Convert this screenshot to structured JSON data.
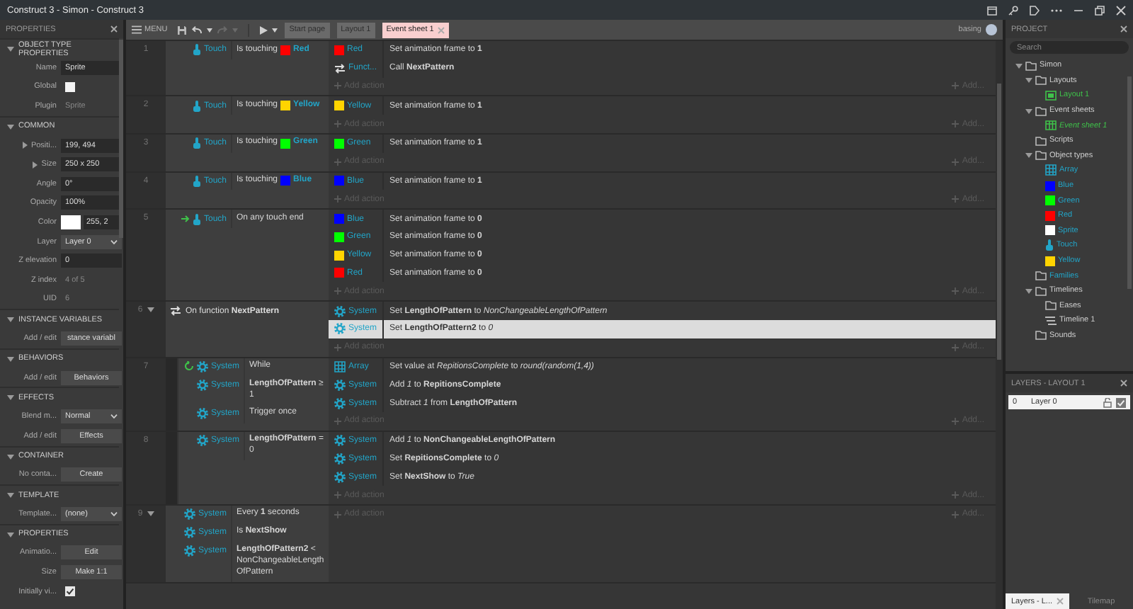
{
  "title_bar": {
    "title": "Construct 3 - Simon - Construct 3"
  },
  "properties": {
    "title": "PROPERTIES",
    "sections": [
      {
        "title": "OBJECT TYPE PROPERTIES",
        "expanded": true,
        "rows": [
          {
            "kind": "field",
            "label": "Name",
            "value": "Sprite"
          },
          {
            "kind": "checkbox",
            "label": "Global",
            "checked": false
          },
          {
            "kind": "text",
            "label": "Plugin",
            "value": "Sprite"
          }
        ]
      },
      {
        "title": "COMMON",
        "expanded": true,
        "rows": [
          {
            "kind": "field",
            "label": "Positi...",
            "value": "199, 494",
            "expanded": false
          },
          {
            "kind": "field",
            "label": "Size",
            "value": "250 x 250",
            "expanded": false
          },
          {
            "kind": "field",
            "label": "Angle",
            "value": "0°"
          },
          {
            "kind": "field",
            "label": "Opacity",
            "value": "100%"
          },
          {
            "kind": "color",
            "label": "Color",
            "color": "#ffffff",
            "value": "255, 2"
          },
          {
            "kind": "select",
            "label": "Layer",
            "value": "Layer 0"
          },
          {
            "kind": "field",
            "label": "Z elevation",
            "value": "0"
          },
          {
            "kind": "text",
            "label": "Z index",
            "value": "4 of 5"
          },
          {
            "kind": "text",
            "label": "UID",
            "value": "6"
          }
        ]
      },
      {
        "title": "INSTANCE VARIABLES",
        "expanded": true,
        "rows": [
          {
            "kind": "button",
            "label": "Add / edit",
            "value": "stance variabl"
          }
        ]
      },
      {
        "title": "BEHAVIORS",
        "expanded": true,
        "rows": [
          {
            "kind": "button",
            "label": "Add / edit",
            "value": "Behaviors"
          }
        ]
      },
      {
        "title": "EFFECTS",
        "expanded": true,
        "rows": [
          {
            "kind": "select",
            "label": "Blend m...",
            "value": "Normal"
          },
          {
            "kind": "button",
            "label": "Add / edit",
            "value": "Effects"
          }
        ]
      },
      {
        "title": "CONTAINER",
        "expanded": true,
        "rows": [
          {
            "kind": "button",
            "label": "No conta...",
            "value": "Create"
          }
        ]
      },
      {
        "title": "TEMPLATE",
        "expanded": true,
        "rows": [
          {
            "kind": "select",
            "label": "Template...",
            "value": "(none)"
          }
        ]
      },
      {
        "title": "PROPERTIES",
        "expanded": true,
        "rows": [
          {
            "kind": "button",
            "label": "Animatio...",
            "value": "Edit"
          },
          {
            "kind": "button",
            "label": "Size",
            "value": "Make 1:1"
          },
          {
            "kind": "checkbox",
            "label": "Initially vi...",
            "checked": true
          }
        ]
      }
    ]
  },
  "toolbar": {
    "menu": "MENU",
    "history": [
      {
        "kind": "undo",
        "disabled": false
      },
      {
        "kind": "redo",
        "disabled": true
      }
    ],
    "tabs": [
      {
        "label": "Start page",
        "selected": false,
        "closable": false
      },
      {
        "label": "Layout 1",
        "selected": false,
        "closable": false
      },
      {
        "label": "Event sheet 1",
        "selected": true,
        "closable": true
      }
    ],
    "user": "basing"
  },
  "events": [
    {
      "number": "1",
      "conditions": [
        {
          "kind": "touch",
          "object": "Touch",
          "text": "Is touching",
          "param": {
            "name": "Red",
            "color": "#ff0000"
          }
        }
      ],
      "actions": [
        {
          "kind": "sprite",
          "color": "#ff0000",
          "object": "Red",
          "text": "Set animation frame to **1**",
          "selected": false
        },
        {
          "kind": "function",
          "object": "Funct...",
          "text": "Call **NextPattern**",
          "selected": false
        }
      ],
      "add_action": "Add action",
      "add_more": "Add..."
    },
    {
      "number": "2",
      "conditions": [
        {
          "kind": "touch",
          "object": "Touch",
          "text": "Is touching",
          "param": {
            "name": "Yellow",
            "color": "#ffd400"
          }
        }
      ],
      "actions": [
        {
          "kind": "sprite",
          "color": "#ffd400",
          "object": "Yellow",
          "text": "Set animation frame to **1**",
          "selected": false
        }
      ],
      "add_action": "Add action",
      "add_more": "Add..."
    },
    {
      "number": "3",
      "conditions": [
        {
          "kind": "touch",
          "object": "Touch",
          "text": "Is touching",
          "param": {
            "name": "Green",
            "color": "#00ff00"
          }
        }
      ],
      "actions": [
        {
          "kind": "sprite",
          "color": "#00ff00",
          "object": "Green",
          "text": "Set animation frame to **1**",
          "selected": false
        }
      ],
      "add_action": "Add action",
      "add_more": "Add..."
    },
    {
      "number": "4",
      "conditions": [
        {
          "kind": "touch",
          "object": "Touch",
          "text": "Is touching",
          "param": {
            "name": "Blue",
            "color": "#0000ff"
          }
        }
      ],
      "actions": [
        {
          "kind": "sprite",
          "color": "#0000ff",
          "object": "Blue",
          "text": "Set animation frame to **1**",
          "selected": false
        }
      ],
      "add_action": "Add action",
      "add_more": "Add..."
    },
    {
      "number": "5",
      "conditions": [
        {
          "kind": "trigger",
          "object": "Touch",
          "text": "On any touch end"
        }
      ],
      "actions": [
        {
          "kind": "sprite",
          "color": "#0000ff",
          "object": "Blue",
          "text": "Set animation frame to **0**",
          "selected": false
        },
        {
          "kind": "sprite",
          "color": "#00ff00",
          "object": "Green",
          "text": "Set animation frame to **0**",
          "selected": false
        },
        {
          "kind": "sprite",
          "color": "#ffd400",
          "object": "Yellow",
          "text": "Set animation frame to **0**",
          "selected": false
        },
        {
          "kind": "sprite",
          "color": "#ff0000",
          "object": "Red",
          "text": "Set animation frame to **0**",
          "selected": false
        }
      ],
      "add_action": "Add action",
      "add_more": "Add..."
    },
    {
      "number": "6",
      "expanded": true,
      "function_header": "On function **NextPattern**",
      "actions": [
        {
          "kind": "system",
          "object": "System",
          "text": "Set **LengthOfPattern** to *NonChangeableLengthOfPattern*",
          "selected": false
        },
        {
          "kind": "system",
          "object": "System",
          "text": "Set **LengthOfPattern2** to *0*",
          "selected": true
        }
      ],
      "add_action": "Add action",
      "add_more": "Add...",
      "children": [
        {
          "number": "7",
          "conditions": [
            {
              "kind": "loop",
              "object": "System",
              "text": "While"
            },
            {
              "kind": "system",
              "object": "System",
              "text": "**LengthOfPattern** ≥ 1"
            },
            {
              "kind": "system",
              "object": "System",
              "text": "Trigger once"
            }
          ],
          "actions": [
            {
              "kind": "array",
              "object": "Array",
              "text": "Set value at *RepitionsComplete* to *round(random(1,4))*",
              "selected": false
            },
            {
              "kind": "system",
              "object": "System",
              "text": "Add *1* to **RepitionsComplete**",
              "selected": false
            },
            {
              "kind": "system",
              "object": "System",
              "text": "Subtract *1* from **LengthOfPattern**",
              "selected": false
            }
          ],
          "add_action": "Add action",
          "add_more": "Add..."
        },
        {
          "number": "8",
          "conditions": [
            {
              "kind": "system",
              "object": "System",
              "text": "**LengthOfPattern** = 0"
            }
          ],
          "actions": [
            {
              "kind": "system",
              "object": "System",
              "text": "Add *1* to **NonChangeableLengthOfPattern**",
              "selected": false
            },
            {
              "kind": "system",
              "object": "System",
              "text": "Set **RepitionsComplete** to *0*",
              "selected": false
            },
            {
              "kind": "system",
              "object": "System",
              "text": "Set **NextShow** to *True*",
              "selected": false
            }
          ],
          "add_action": "Add action",
          "add_more": "Add..."
        }
      ]
    },
    {
      "number": "9",
      "expanded": true,
      "conditions": [
        {
          "kind": "system",
          "object": "System",
          "text": "Every **1** seconds"
        },
        {
          "kind": "system",
          "object": "System",
          "text": "Is **NextShow**"
        },
        {
          "kind": "system",
          "object": "System",
          "text": "**LengthOfPattern2** < NonChangeableLengthOfPattern"
        }
      ],
      "add_action": "Add action",
      "add_more": "Add..."
    }
  ],
  "project": {
    "title": "PROJECT",
    "search": {
      "placeholder": "Search"
    },
    "tree": [
      {
        "label": "Simon",
        "kind": "folder",
        "expanded": true,
        "children": [
          {
            "label": "Layouts",
            "kind": "folder",
            "expanded": true,
            "children": [
              {
                "label": "Layout 1",
                "kind": "layout"
              }
            ]
          },
          {
            "label": "Event sheets",
            "kind": "folder",
            "expanded": true,
            "children": [
              {
                "label": "Event sheet 1",
                "kind": "event_sheet"
              }
            ]
          },
          {
            "label": "Scripts",
            "kind": "folder"
          },
          {
            "label": "Object types",
            "kind": "folder",
            "expanded": true,
            "children": [
              {
                "label": "Array",
                "kind": "array"
              },
              {
                "label": "Blue",
                "kind": "sprite",
                "color": "#0000ff"
              },
              {
                "label": "Green",
                "kind": "sprite",
                "color": "#00ff00"
              },
              {
                "label": "Red",
                "kind": "sprite",
                "color": "#ff0000"
              },
              {
                "label": "Sprite",
                "kind": "sprite",
                "color": "#ffffff"
              },
              {
                "label": "Touch",
                "kind": "touch"
              },
              {
                "label": "Yellow",
                "kind": "sprite",
                "color": "#ffd400"
              }
            ]
          },
          {
            "label": "Families",
            "kind": "family"
          },
          {
            "label": "Timelines",
            "kind": "folder",
            "expanded": true,
            "children": [
              {
                "label": "Eases",
                "kind": "folder"
              },
              {
                "label": "Timeline 1",
                "kind": "timeline"
              }
            ]
          },
          {
            "label": "Sounds",
            "kind": "folder"
          }
        ]
      }
    ]
  },
  "layers": {
    "title": "LAYERS - LAYOUT 1",
    "layers": [
      {
        "index": "0",
        "name": "Layer 0",
        "locked": false,
        "visible": true
      }
    ],
    "tabs": [
      {
        "label": "Layers - L...",
        "selected": true,
        "closable": true
      },
      {
        "label": "Tilemap",
        "selected": false,
        "closable": false
      }
    ]
  }
}
